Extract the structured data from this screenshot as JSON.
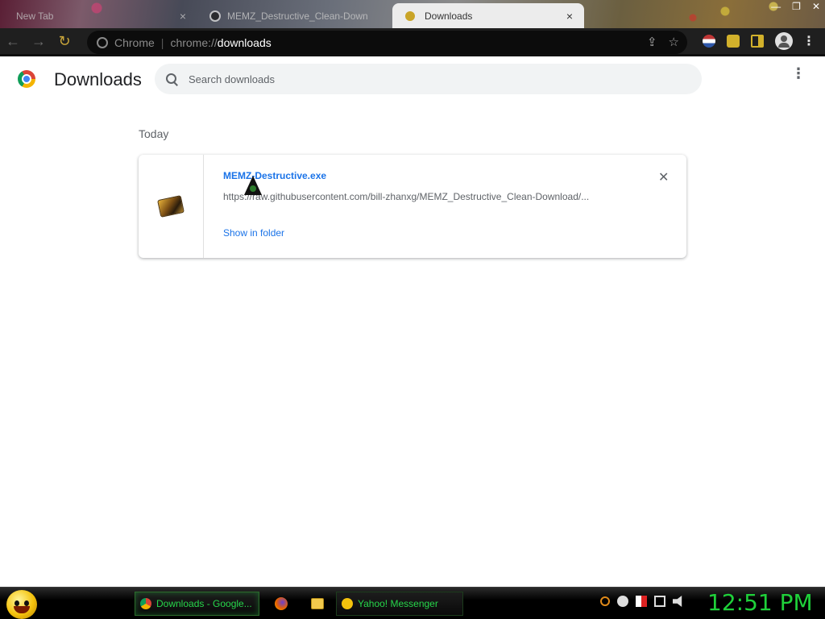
{
  "window": {
    "tabs": [
      {
        "label": "New Tab",
        "close": "×"
      },
      {
        "label": "MEMZ_Destructive_Clean-Down",
        "close": "×"
      },
      {
        "label": "Downloads",
        "close": "×"
      }
    ],
    "controls": {
      "minimize": "—",
      "maximize": "❐",
      "close": "✕"
    }
  },
  "toolbar": {
    "back": "←",
    "forward": "→",
    "reload": "↻",
    "site_label": "Chrome",
    "separator": "|",
    "url_scheme": "chrome://",
    "url_host": "downloads",
    "share": "⇪",
    "bookmark": "☆",
    "menu": "⋮"
  },
  "downloads_page": {
    "title": "Downloads",
    "search": {
      "placeholder": "Search downloads",
      "value": ""
    },
    "more": "⋮",
    "section_date": "Today",
    "items": [
      {
        "file_name": "MEMZ-Destructive.exe",
        "url": "https://raw.githubusercontent.com/bill-zhanxg/MEMZ_Destructive_Clean-Download/...",
        "action": "Show in folder",
        "remove": "✕"
      }
    ]
  },
  "taskbar": {
    "tasks": [
      {
        "label": "Downloads - Google..."
      },
      {
        "label": "Yahoo! Messenger"
      }
    ],
    "clock": "12:51 PM"
  }
}
